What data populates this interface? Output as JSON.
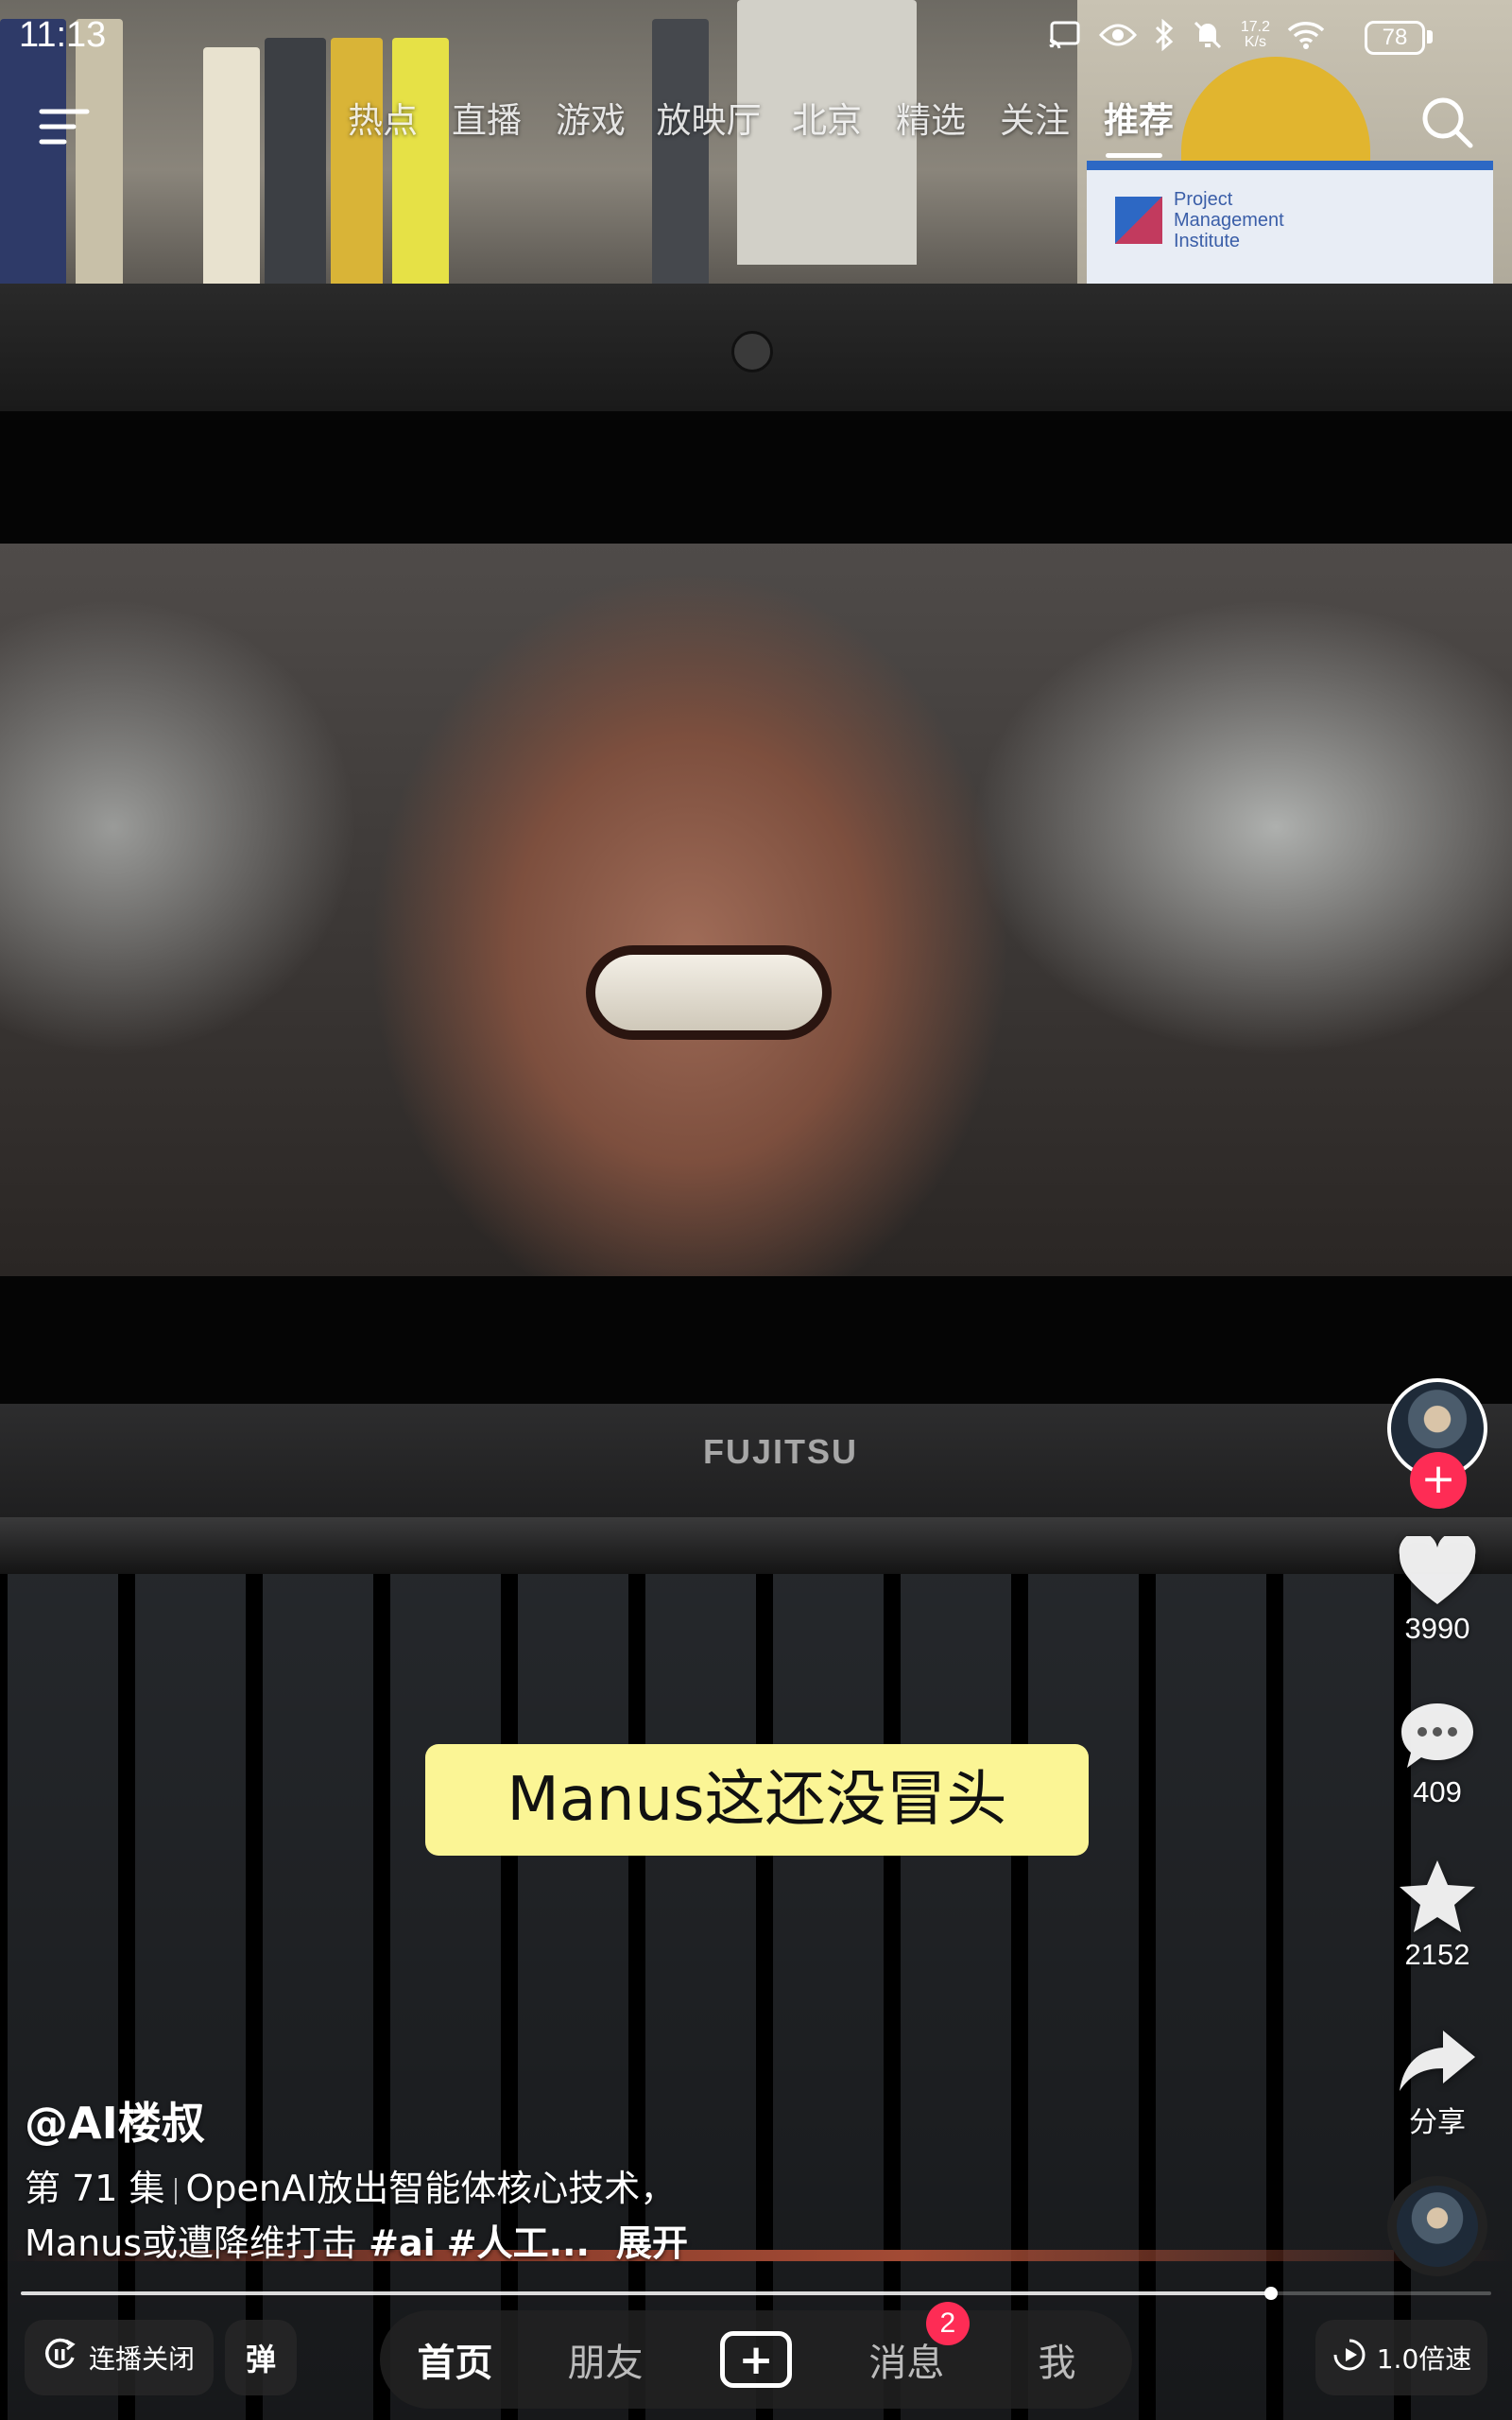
{
  "status_bar": {
    "time": "11:13",
    "net_speed_value": "17.2",
    "net_speed_unit": "K/s",
    "battery": "78",
    "icons": [
      "cast-icon",
      "eye-icon",
      "bluetooth-icon",
      "mute-icon",
      "wifi-icon",
      "battery-icon"
    ]
  },
  "top_nav": {
    "tabs": [
      {
        "label": "热点"
      },
      {
        "label": "直播"
      },
      {
        "label": "游戏"
      },
      {
        "label": "放映厅"
      },
      {
        "label": "北京"
      },
      {
        "label": "精选"
      },
      {
        "label": "关注"
      },
      {
        "label": "推荐",
        "active": true
      }
    ]
  },
  "video": {
    "laptop_brand": "FUJITSU",
    "poster_text": [
      "Project",
      "Management",
      "Institute"
    ],
    "caption": "Manus这还没冒头"
  },
  "side_actions": {
    "like_count": "3990",
    "comment_count": "409",
    "favorite_count": "2152",
    "share_label": "分享"
  },
  "post": {
    "author": "@AI楼叔",
    "episode": "第 71 集",
    "description_line1": "OpenAI放出智能体核心技术，",
    "description_line2": "Manus或遭降维打击",
    "hashtag1": "#ai",
    "hashtag2": "#人工...",
    "expand_label": "展开"
  },
  "playback": {
    "progress": 0.85
  },
  "bottom_bar": {
    "autoplay_label": "连播关闭",
    "danmu_label": "弹",
    "nav": {
      "home": "首页",
      "friends": "朋友",
      "create": "+",
      "messages": "消息",
      "me": "我"
    },
    "messages_badge": "2",
    "speed_label": "1.0倍速"
  },
  "colors": {
    "accent": "#fe2c55",
    "caption_bg": "#fbf595"
  }
}
